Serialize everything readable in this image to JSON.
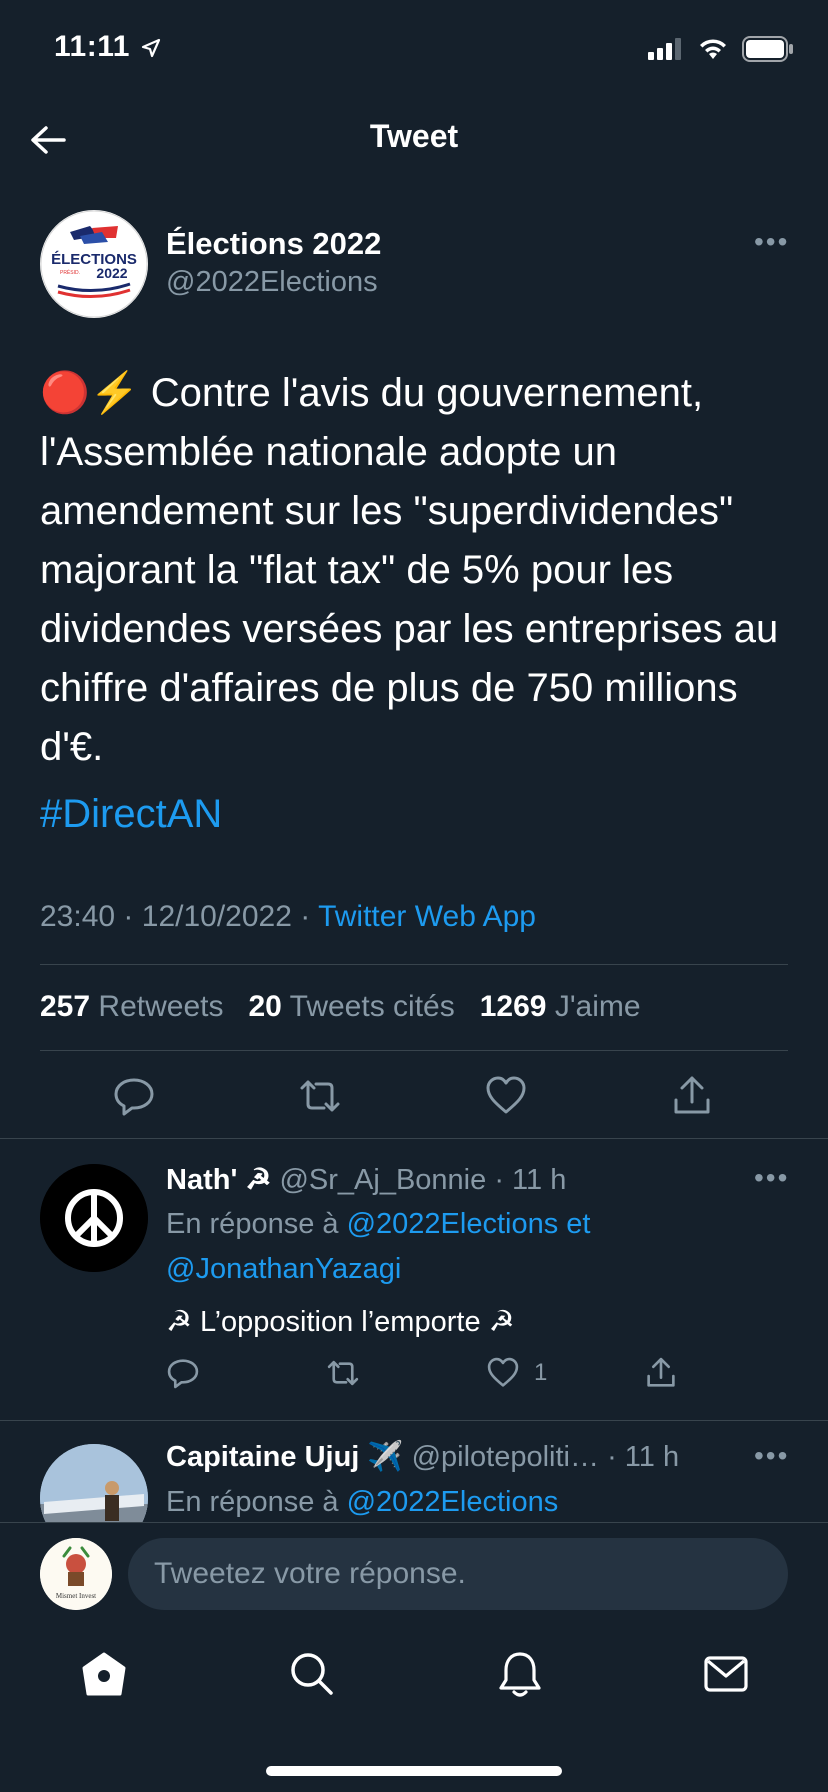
{
  "status_bar": {
    "time": "11:11"
  },
  "header": {
    "title": "Tweet"
  },
  "tweet": {
    "author_name": "Élections 2022",
    "author_handle": "@2022Elections",
    "avatar_text_top": "ÉLECTIONS",
    "avatar_text_mid": "PRÉSIDENTIELLE LÉGISLATIVES",
    "avatar_text_year": "2022",
    "text": "🔴⚡ Contre l'avis du gouvernement, l'Assemblée nationale adopte un amendement sur les \"superdividendes\" majorant la \"flat tax\" de 5% pour les dividendes versées par les entreprises au chiffre d'affaires de plus de 750 millions d'€.",
    "hashtag": "#DirectAN",
    "time": "23:40",
    "date": "12/10/2022",
    "separator": "·",
    "source": "Twitter Web App",
    "stats": {
      "retweets_count": "257",
      "retweets_label": "Retweets",
      "quotes_count": "20",
      "quotes_label": "Tweets cités",
      "likes_count": "1269",
      "likes_label": "J'aime"
    }
  },
  "replies": [
    {
      "name": "Nath' ☭",
      "handle": "@Sr_Aj_Bonnie",
      "time": "· 11 h",
      "in_reply_prefix": "En réponse à",
      "in_reply_to": "@2022Elections et",
      "in_reply_to_2": "@JonathanYazagi",
      "text": "☭ L’opposition l’emporte ☭",
      "likes": "1"
    },
    {
      "name": "Capitaine Ujuj ✈️",
      "handle": "@pilotepoliti…",
      "time": "· 11 h",
      "in_reply_prefix": "En réponse à",
      "in_reply_to": "@2022Elections"
    }
  ],
  "composer": {
    "placeholder": "Tweetez votre réponse.",
    "avatar_label": "Mismet Invest"
  },
  "colors": {
    "background": "#15202b",
    "accent": "#1d9bf0",
    "muted": "#8899a6",
    "divider": "#38444d"
  },
  "icons": [
    "location-arrow-icon",
    "signal-icon",
    "wifi-icon",
    "battery-icon",
    "back-arrow-icon",
    "more-icon",
    "reply-icon",
    "retweet-icon",
    "like-icon",
    "share-icon",
    "peace-icon",
    "home-icon",
    "search-icon",
    "bell-icon",
    "mail-icon"
  ]
}
